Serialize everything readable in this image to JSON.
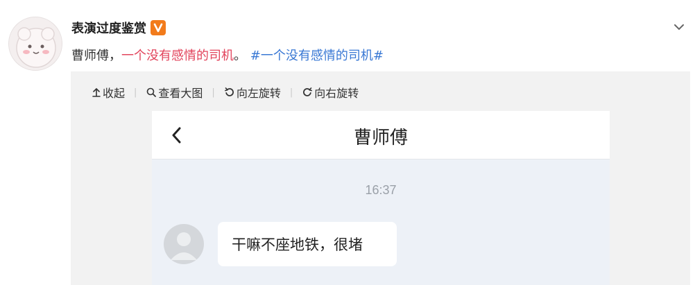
{
  "post": {
    "username": "表演过度鉴赏",
    "verified_badge_icon": "verified-v-icon",
    "text_plain": "曹师傅，",
    "text_link": "一个没有感情的司机",
    "text_period": "。",
    "hashtag": "#一个没有感情的司机#"
  },
  "toolbar": {
    "collapse_label": "收起",
    "view_large_label": "查看大图",
    "rotate_left_label": "向左旋转",
    "rotate_right_label": "向右旋转"
  },
  "screenshot": {
    "chat_title": "曹师傅",
    "time": "16:37",
    "message": "干嘛不座地铁，很堵"
  },
  "colors": {
    "link_red": "#e2445c",
    "hashtag_blue": "#3978d4",
    "badge_orange": "#f27b1b"
  }
}
